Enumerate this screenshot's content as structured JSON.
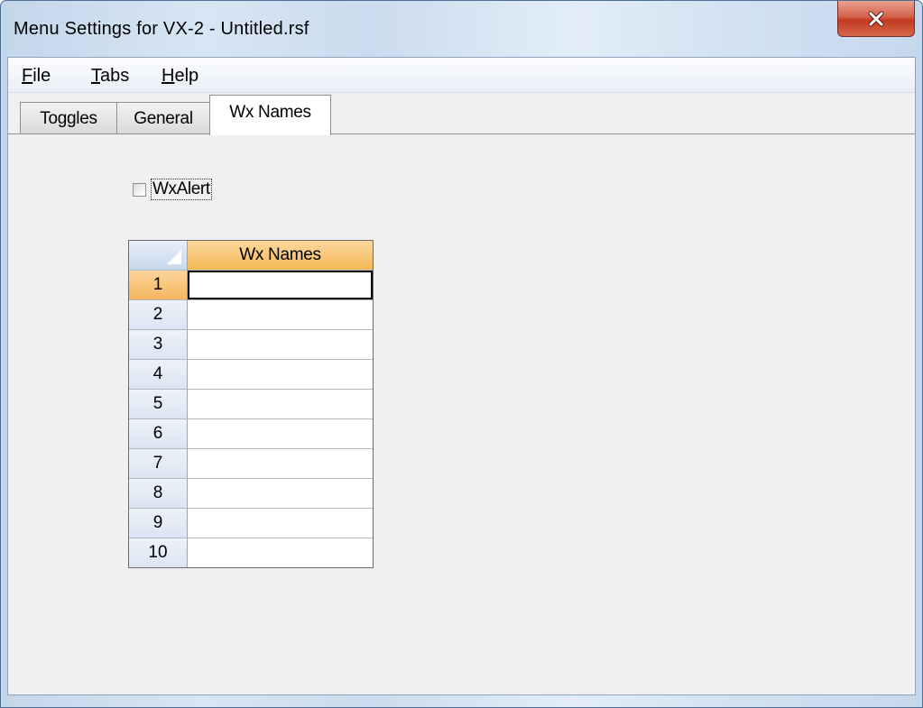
{
  "window": {
    "title": "Menu Settings for VX-2 - Untitled.rsf",
    "close_icon": "close-x-icon"
  },
  "menu": {
    "items": [
      {
        "mnemonic": "F",
        "rest": "ile"
      },
      {
        "mnemonic": "T",
        "rest": "abs"
      },
      {
        "mnemonic": "H",
        "rest": "elp"
      }
    ]
  },
  "tabs": [
    {
      "label": "Toggles",
      "active": false
    },
    {
      "label": "General",
      "active": false
    },
    {
      "label": "Wx Names",
      "active": true
    }
  ],
  "wxalert": {
    "label": "WxAlert",
    "checked": false
  },
  "grid": {
    "column_header": "Wx Names",
    "selected_row": 1,
    "rows": [
      {
        "num": "1",
        "value": ""
      },
      {
        "num": "2",
        "value": ""
      },
      {
        "num": "3",
        "value": ""
      },
      {
        "num": "4",
        "value": ""
      },
      {
        "num": "5",
        "value": ""
      },
      {
        "num": "6",
        "value": ""
      },
      {
        "num": "7",
        "value": ""
      },
      {
        "num": "8",
        "value": ""
      },
      {
        "num": "9",
        "value": ""
      },
      {
        "num": "10",
        "value": ""
      }
    ]
  }
}
